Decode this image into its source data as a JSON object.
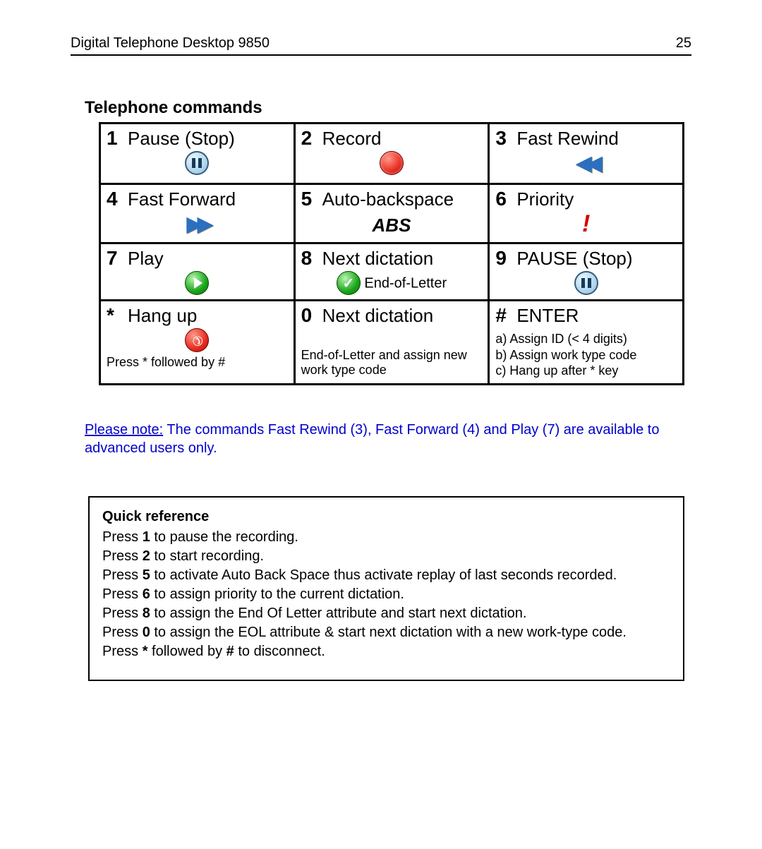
{
  "header": {
    "title": "Digital Telephone Desktop 9850",
    "page": "25"
  },
  "section_title": "Telephone commands",
  "cells": {
    "c1": {
      "key": "1",
      "label": "Pause (Stop)"
    },
    "c2": {
      "key": "2",
      "label": "Record"
    },
    "c3": {
      "key": "3",
      "label": "Fast Rewind"
    },
    "c4": {
      "key": "4",
      "label": "Fast Forward"
    },
    "c5": {
      "key": "5",
      "label": "Auto-backspace",
      "sub": "ABS"
    },
    "c6": {
      "key": "6",
      "label": "Priority",
      "mark": "!"
    },
    "c7": {
      "key": "7",
      "label": "Play"
    },
    "c8": {
      "key": "8",
      "label": "Next dictation",
      "sub": "End-of-Letter"
    },
    "c9": {
      "key": "9",
      "label": "PAUSE (Stop)"
    },
    "cstar": {
      "key": "*",
      "label": "Hang up",
      "sub": "Press * followed by #"
    },
    "c0": {
      "key": "0",
      "label": "Next dictation",
      "sub": "End-of-Letter and assign new work type code"
    },
    "chash": {
      "key": "#",
      "label": "ENTER",
      "a": "a) Assign ID (< 4 digits)",
      "b": "b) Assign work type code",
      "c": "c) Hang up after * key"
    }
  },
  "note": {
    "lead": "Please note:",
    "body": "  The commands Fast Rewind (3), Fast Forward (4) and Play (7) are available to advanced users only."
  },
  "quickref": {
    "title": "Quick reference",
    "l1a": "Press ",
    "l1b": "1",
    "l1c": " to pause the recording.",
    "l2a": "Press ",
    "l2b": "2",
    "l2c": " to start recording.",
    "l3a": "Press ",
    "l3b": "5",
    "l3c": " to activate Auto Back Space thus activate replay of last seconds recorded.",
    "l4a": "Press ",
    "l4b": "6",
    "l4c": " to assign priority to the current dictation.",
    "l5a": "Press ",
    "l5b": "8",
    "l5c": " to assign the End Of Letter attribute and start next dictation.",
    "l6a": "Press ",
    "l6b": "0",
    "l6c": " to assign the EOL attribute & start next dictation with a new work-type code.",
    "l7a": "Press ",
    "l7b": "*",
    "l7c": " followed by ",
    "l7d": "#",
    "l7e": " to disconnect."
  }
}
